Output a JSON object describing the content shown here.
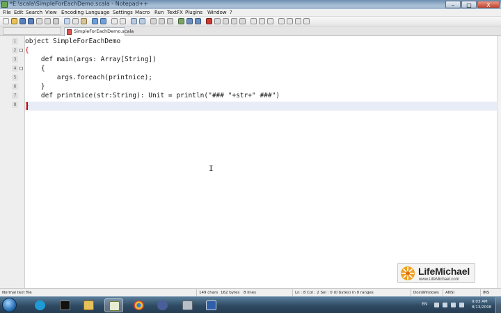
{
  "window": {
    "title": "*E:\\scala\\SimpleForEachDemo.scala - Notepad++",
    "controls": {
      "minimize": "–",
      "maximize": "□",
      "close": "X"
    }
  },
  "menu": {
    "items": [
      "File",
      "Edit",
      "Search",
      "View",
      "Encoding",
      "Language",
      "Settings",
      "Macro",
      "Run",
      "TextFX",
      "Plugins",
      "Window",
      "?"
    ]
  },
  "tab": {
    "filename": "SimpleForEachDemo.scala"
  },
  "editor": {
    "line_numbers": [
      "1",
      "2",
      "3",
      "4",
      "5",
      "6",
      "7",
      "8"
    ],
    "lines": [
      "object SimpleForEachDemo",
      "{",
      "    def main(args: Array[String])",
      "    {",
      "        args.foreach(printnice);",
      "    }",
      "    def printnice(str:String): Unit = println(\"### \"+str+\" ###\")",
      "}"
    ],
    "cursor_symbol": "I"
  },
  "logo": {
    "name": "LifeMichael",
    "url": "www.LifeMichael.com"
  },
  "status": {
    "file_type": "Normal text file",
    "length": "149 chars",
    "bytes": "162 bytes",
    "lines": "8 lines",
    "position": "Ln : 8    Col : 2    Sel : 0 (0 bytes) in 0 ranges",
    "eol": "Dos\\Windows",
    "encoding": "ANSI",
    "mode": "INS"
  },
  "taskbar": {
    "language": "EN",
    "time": "9:03 AM",
    "date": "8/13/2008"
  },
  "colors": {
    "accent": "#cc0000",
    "current_line": "#e8ecf6",
    "taskbar": "#2e4a63"
  }
}
